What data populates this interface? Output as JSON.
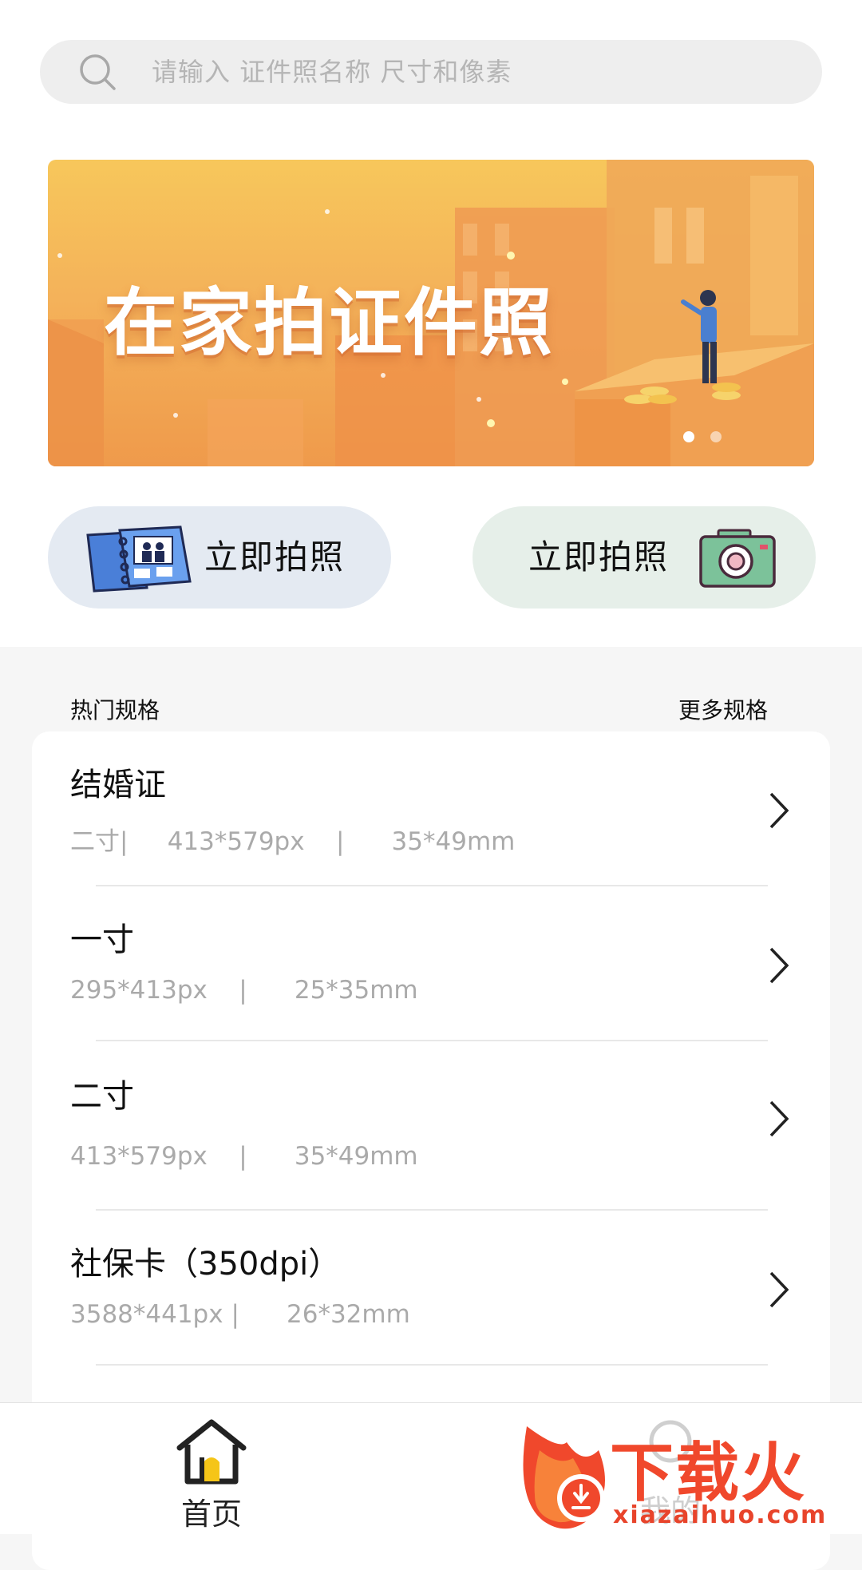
{
  "search": {
    "placeholder": "请输入 证件照名称 尺寸和像素",
    "icon": "search-icon"
  },
  "banner": {
    "title": "在家拍证件照",
    "slides": 2,
    "active_slide": 1
  },
  "actions": [
    {
      "label": "立即拍照",
      "icon": "photo-album-icon",
      "bg": "#e4eaf2"
    },
    {
      "label": "立即拍照",
      "icon": "camera-icon",
      "bg": "#e6efe9"
    }
  ],
  "section": {
    "title": "热门规格",
    "more": "更多规格"
  },
  "specs": [
    {
      "name": "结婚证",
      "detail": "二寸|     413*579px    |      35*49mm"
    },
    {
      "name": "一寸",
      "detail": "295*413px    |      25*35mm"
    },
    {
      "name": "二寸",
      "detail": "413*579px    |      35*49mm"
    },
    {
      "name": "社保卡（350dpi）",
      "detail": "3588*441px |      26*32mm"
    }
  ],
  "tabbar": {
    "home": {
      "label": "首页",
      "icon": "home-icon",
      "accent": "#f5c518"
    },
    "me": {
      "label": "我的",
      "icon": "user-icon"
    }
  },
  "watermark": {
    "text": "下载火",
    "url": "xiazaihuo.com",
    "color": "#f0482c"
  }
}
